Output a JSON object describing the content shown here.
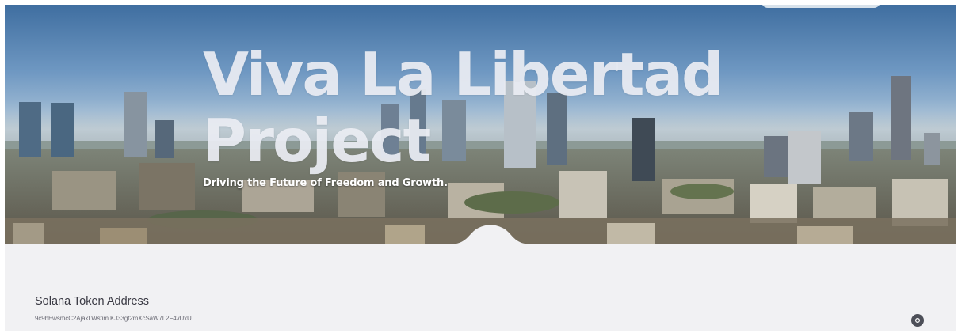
{
  "hero": {
    "title_line1": "Viva La Libertad",
    "title_line2": "Project",
    "subtitle": "Driving the Future of Freedom and Growth."
  },
  "token": {
    "heading": "Solana Token Address",
    "address": "9c9hEwsmcC2AjakLWsfim KJ33gt2mXcSaW7L2F4vUxU"
  },
  "icons": {
    "copy": "copy-icon"
  },
  "colors": {
    "section_background": "#f1f1f3",
    "heading_text": "#3a3a44",
    "button_background": "#4d4f58",
    "title_text": "#eceef4"
  }
}
